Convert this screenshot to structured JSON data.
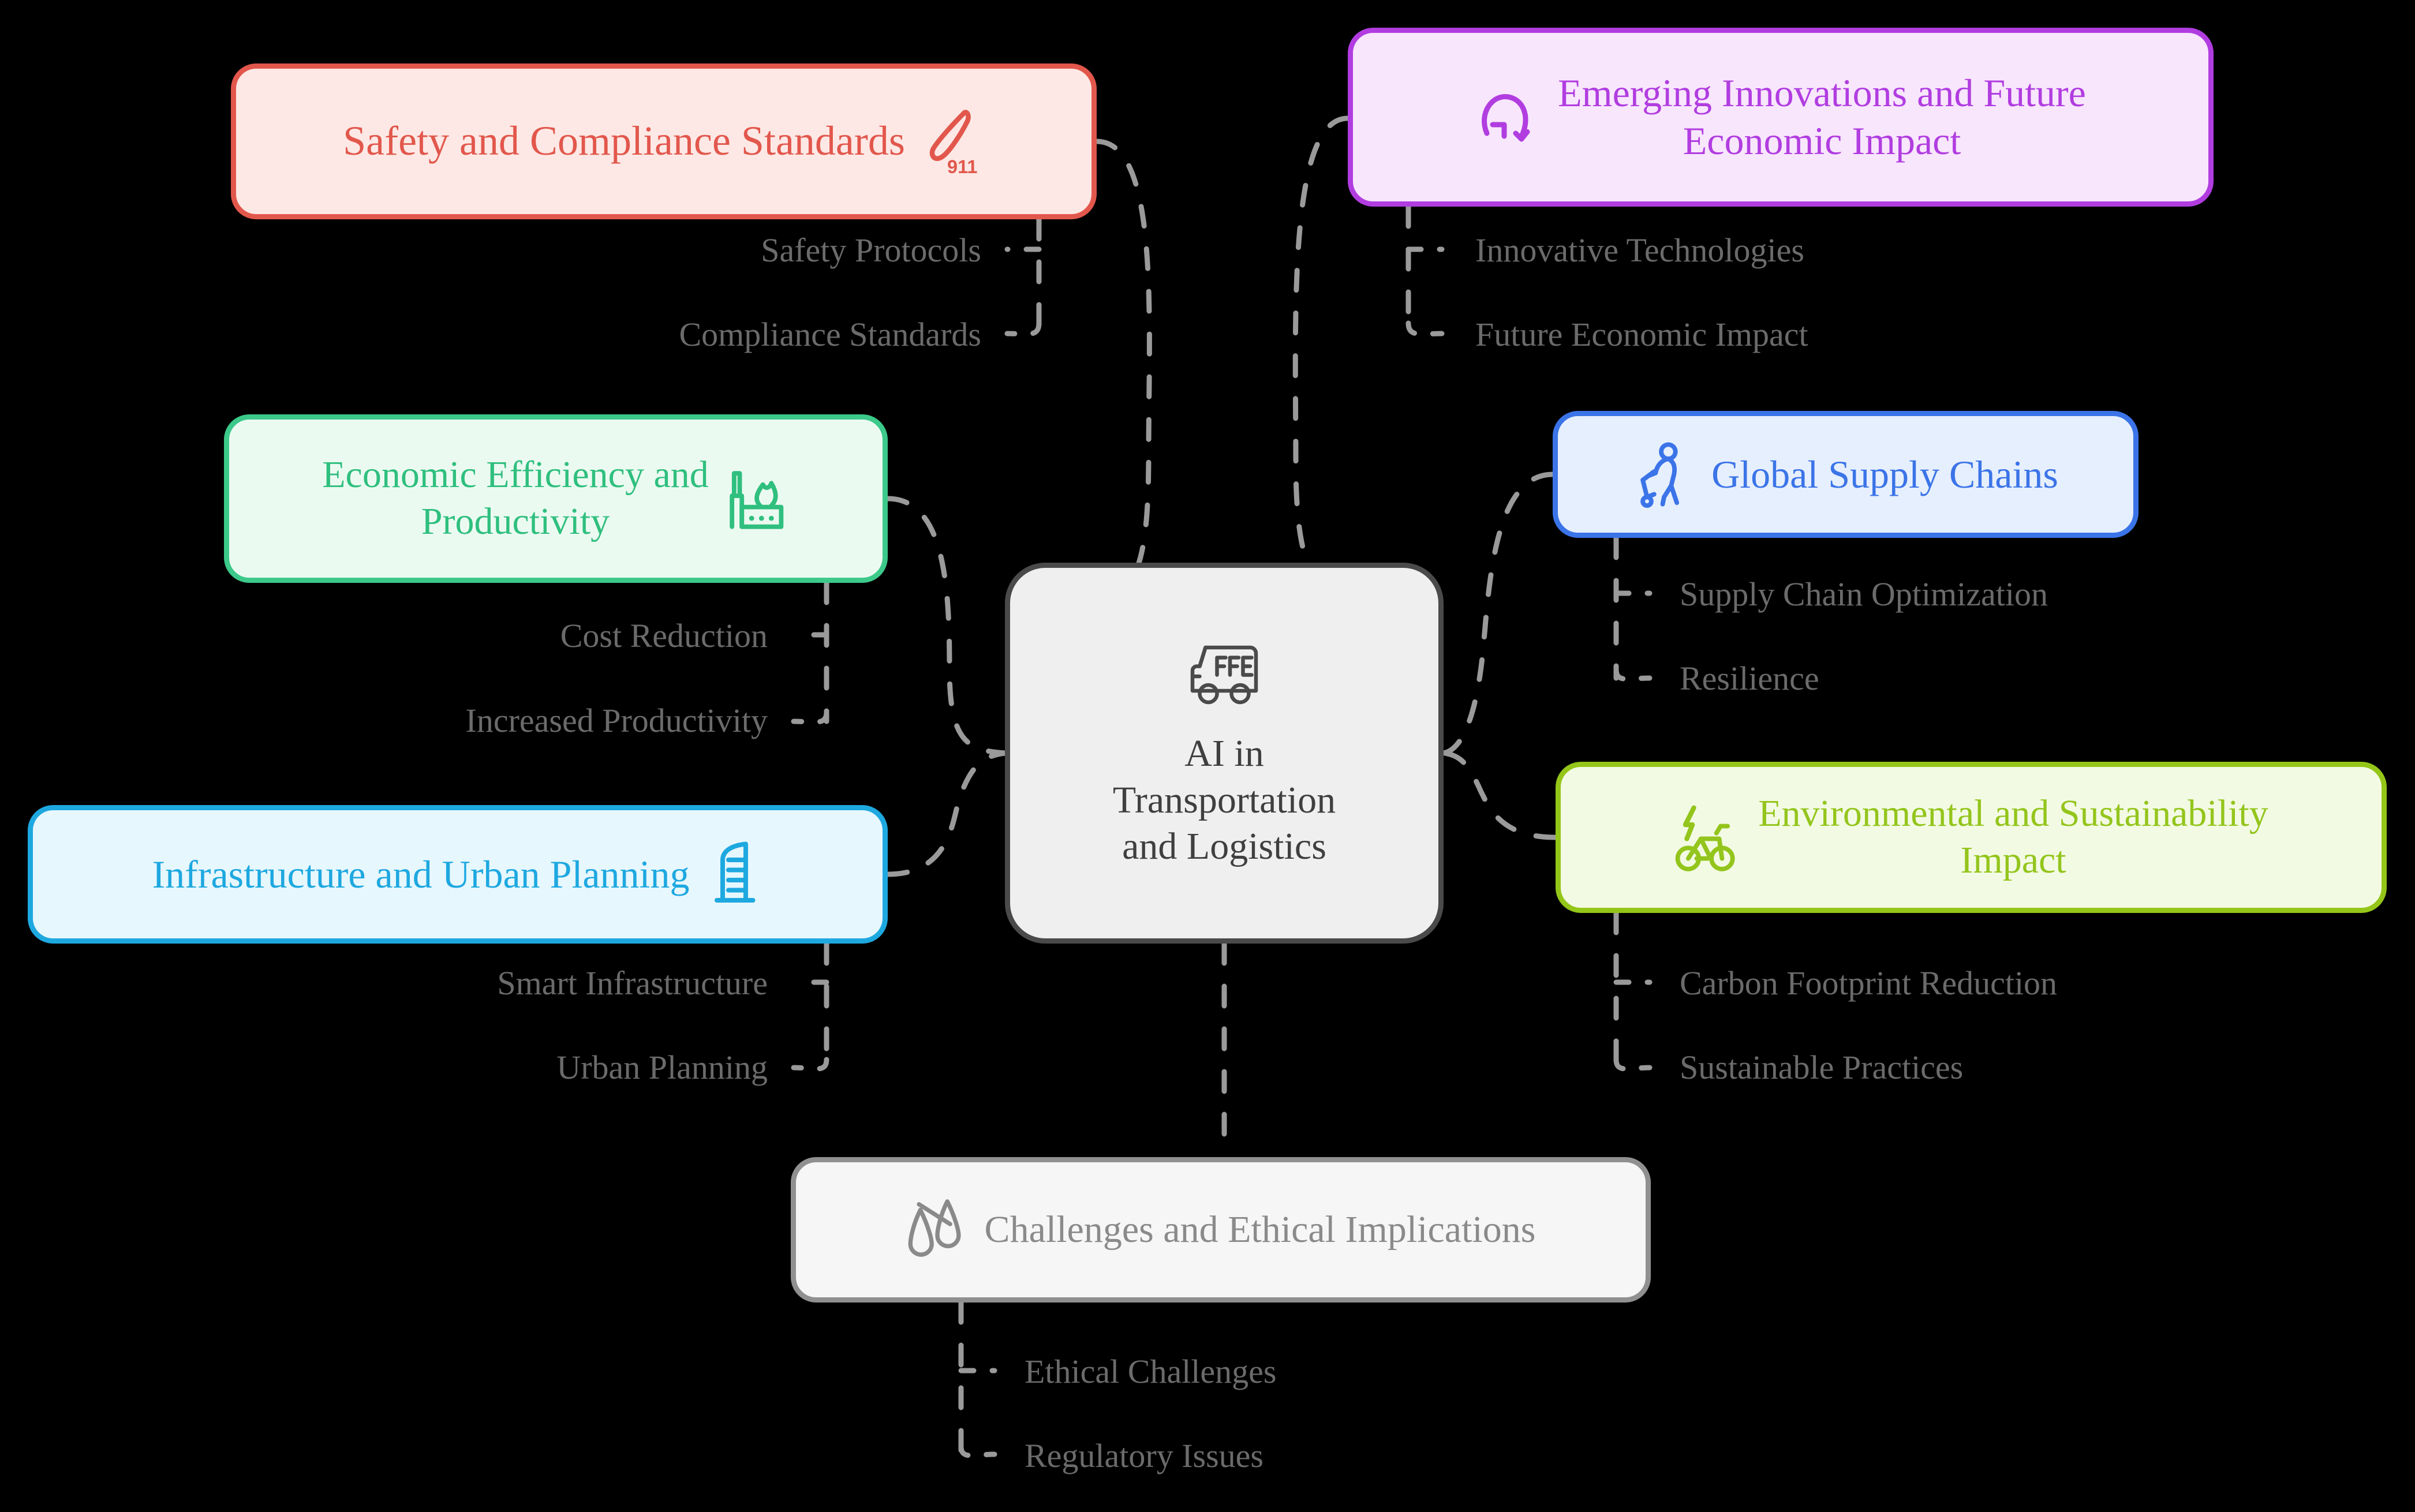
{
  "diagram": {
    "type": "mind-map",
    "background": "#000000",
    "center": {
      "id": "center",
      "label": "AI in\nTransportation\nand Logistics",
      "icon": "delivery-truck-free-icon",
      "icon_text": "FREE",
      "fill": "#EFEFEF",
      "border": "#4A4A4A",
      "text_color": "#3F3F3F"
    },
    "branches": [
      {
        "id": "safety",
        "label": "Safety and Compliance Standards",
        "icon": "emergency-phone-911-icon",
        "icon_text": "911",
        "fill": "#FDE8E5",
        "border": "#E2574C",
        "text_color": "#E2574C",
        "children": [
          "Safety Protocols",
          "Compliance Standards"
        ]
      },
      {
        "id": "emerging",
        "label": "Emerging Innovations and Future\nEconomic Impact",
        "icon": "refresh-arrow-icon",
        "fill": "#F8E6FD",
        "border": "#B13DE0",
        "text_color": "#B13DE0",
        "children": [
          "Innovative Technologies",
          "Future Economic Impact"
        ]
      },
      {
        "id": "economic",
        "label": "Economic Efficiency and\nProductivity",
        "icon": "factory-icon",
        "fill": "#EBFAF1",
        "border": "#3CC98A",
        "text_color": "#2FBF7E",
        "children": [
          "Cost Reduction",
          "Increased Productivity"
        ]
      },
      {
        "id": "supply",
        "label": "Global Supply Chains",
        "icon": "porter-luggage-cart-icon",
        "fill": "#E6EFFD",
        "border": "#3B74E8",
        "text_color": "#3B74E8",
        "children": [
          "Supply Chain Optimization",
          "Resilience"
        ]
      },
      {
        "id": "infrastructure",
        "label": "Infrastructure and Urban Planning",
        "icon": "skyscraper-icon",
        "fill": "#E6F7FD",
        "border": "#1EA8E0",
        "text_color": "#1EA8E0",
        "children": [
          "Smart Infrastructure",
          "Urban Planning"
        ]
      },
      {
        "id": "environment",
        "label": "Environmental and Sustainability\nImpact",
        "icon": "electric-bicycle-icon",
        "fill": "#F3FAE3",
        "border": "#94C619",
        "text_color": "#93C51C",
        "children": [
          "Carbon Footprint Reduction",
          "Sustainable Practices"
        ]
      },
      {
        "id": "challenges",
        "label": "Challenges and Ethical Implications",
        "icon": "balance-scales-icon",
        "fill": "#F6F6F6",
        "border": "#909090",
        "text_color": "#8A8A8A",
        "children": [
          "Ethical Challenges",
          "Regulatory Issues"
        ]
      }
    ],
    "sub_labels": {
      "safety_0": "Safety Protocols",
      "safety_1": "Compliance Standards",
      "emerging_0": "Innovative Technologies",
      "emerging_1": "Future Economic Impact",
      "economic_0": "Cost Reduction",
      "economic_1": "Increased Productivity",
      "supply_0": "Supply Chain Optimization",
      "supply_1": "Resilience",
      "infrastructure_0": "Smart Infrastructure",
      "infrastructure_1": "Urban Planning",
      "environment_0": "Carbon Footprint Reduction",
      "environment_1": "Sustainable Practices",
      "challenges_0": "Ethical Challenges",
      "challenges_1": "Regulatory Issues"
    },
    "edge_color": "#9A9A9A"
  }
}
